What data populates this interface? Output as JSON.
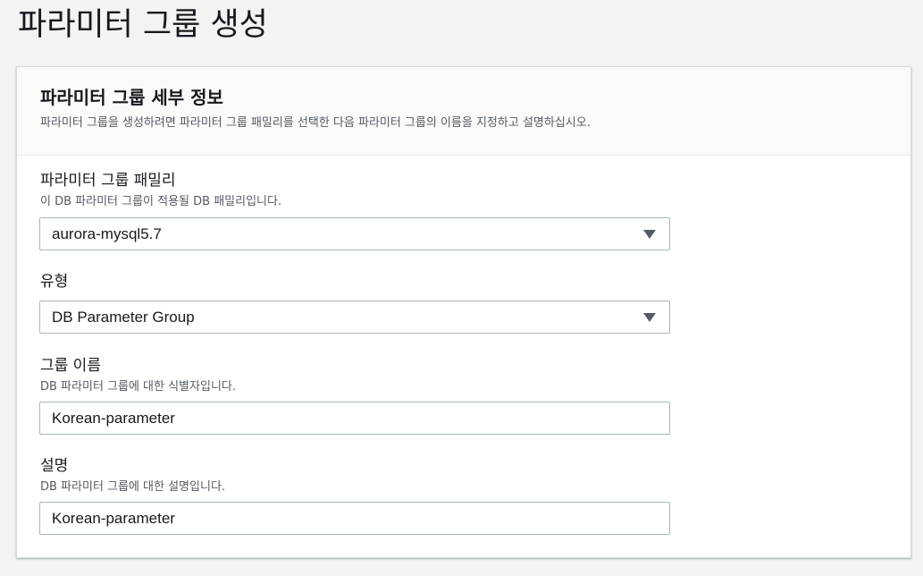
{
  "page": {
    "title": "파라미터 그룹 생성"
  },
  "panel": {
    "title": "파라미터 그룹 세부 정보",
    "description": "파라미터 그룹을 생성하려면 파라미터 그룹 패밀리를 선택한 다음 파라미터 그룹의 이름을 지정하고 설명하십시오."
  },
  "fields": {
    "family": {
      "label": "파라미터 그룹 패밀리",
      "hint": "이 DB 파라미터 그룹이 적용될 DB 패밀리입니다.",
      "value": "aurora-mysql5.7"
    },
    "type": {
      "label": "유형",
      "value": "DB Parameter Group"
    },
    "group_name": {
      "label": "그룹 이름",
      "hint": "DB 파라미터 그룹에 대한 식별자입니다.",
      "value": "Korean-parameter"
    },
    "description": {
      "label": "설명",
      "hint": "DB 파라미터 그룹에 대한 설명입니다.",
      "value": "Korean-parameter"
    }
  },
  "icons": {
    "select_caret": "caret-down-icon"
  },
  "colors": {
    "page_bg": "#f2f3f3",
    "panel_bg": "#ffffff",
    "header_bg": "#fafafa",
    "border": "#aab7b8",
    "text": "#16191f",
    "secondary_text": "#545b64"
  }
}
